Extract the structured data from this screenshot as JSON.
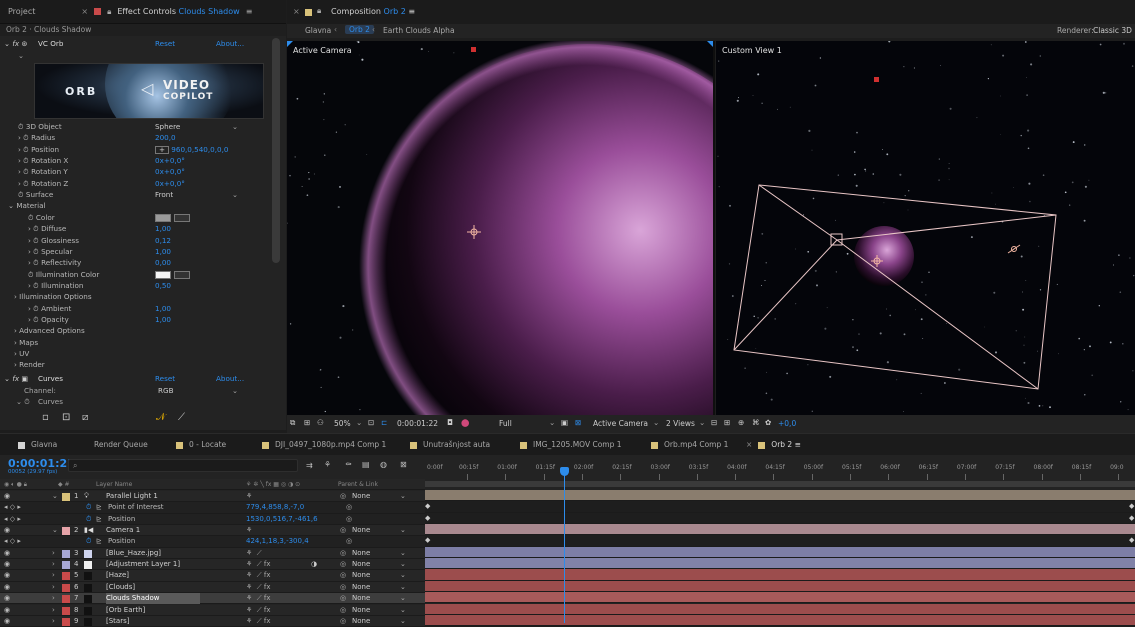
{
  "left_panel": {
    "tab_project": "Project",
    "tab_effect_controls_prefix": "Effect Controls ",
    "tab_effect_controls_layer": "Clouds Shadow",
    "subtitle": "Orb 2 · Clouds Shadow",
    "orb_effect": {
      "label": "VC Orb",
      "reset": "Reset",
      "about": "About..."
    },
    "banner_left": "ORB",
    "banner_right1": "VIDEO",
    "banner_right2": "COPILOT",
    "props": [
      {
        "label": "3D Object",
        "value": "Sphere",
        "kind": "dropdown"
      },
      {
        "label": "Radius",
        "value": "200,0",
        "kind": "num"
      },
      {
        "label": "Position",
        "value": "960,0,540,0,0,0",
        "kind": "pos"
      },
      {
        "label": "Rotation X",
        "value": "0x+0,0°",
        "kind": "num"
      },
      {
        "label": "Rotation Y",
        "value": "0x+0,0°",
        "kind": "num"
      },
      {
        "label": "Rotation Z",
        "value": "0x+0,0°",
        "kind": "num"
      },
      {
        "label": "Surface",
        "value": "Front",
        "kind": "dropdown"
      },
      {
        "label": "Material",
        "value": "",
        "kind": "group"
      },
      {
        "label": "Color",
        "value": "",
        "kind": "color-gray"
      },
      {
        "label": "Diffuse",
        "value": "1,00",
        "kind": "num"
      },
      {
        "label": "Glossiness",
        "value": "0,12",
        "kind": "num"
      },
      {
        "label": "Specular",
        "value": "1,00",
        "kind": "num"
      },
      {
        "label": "Reflectivity",
        "value": "0,00",
        "kind": "num"
      },
      {
        "label": "Illumination Color",
        "value": "",
        "kind": "color-white"
      },
      {
        "label": "Illumination",
        "value": "0,50",
        "kind": "num"
      },
      {
        "label": "Illumination Options",
        "value": "",
        "kind": "group"
      },
      {
        "label": "Ambient",
        "value": "1,00",
        "kind": "num"
      },
      {
        "label": "Opacity",
        "value": "1,00",
        "kind": "num"
      },
      {
        "label": "Advanced Options",
        "value": "",
        "kind": "group"
      },
      {
        "label": "Maps",
        "value": "",
        "kind": "group"
      },
      {
        "label": "UV",
        "value": "",
        "kind": "group"
      },
      {
        "label": "Render",
        "value": "",
        "kind": "group"
      }
    ],
    "curves": {
      "label": "Curves",
      "reset": "Reset",
      "about": "About...",
      "channel_label": "Channel:",
      "channel_value": "RGB",
      "curves_label": "Curves"
    }
  },
  "comp": {
    "tab_prefix": "Composition ",
    "tab_name": "Orb 2",
    "sub_tabs": [
      "Glavna",
      "Orb 2",
      "Earth Clouds Alpha"
    ],
    "renderer_label": "Renderer:",
    "renderer_value": "Classic 3D",
    "view_left_label": "Active Camera",
    "view_right_label": "Custom View 1",
    "viewer_bar": {
      "zoom": "50%",
      "timecode": "0:00:01:22",
      "quality": "Full",
      "camera": "Active Camera",
      "views": "2 Views",
      "exposure": "+0,0"
    }
  },
  "project_tabs": [
    {
      "label": "Glavna",
      "color": "#d4d4d4"
    },
    {
      "label": "Render Queue",
      "color": ""
    },
    {
      "label": "0 - Locate",
      "color": "#d9c27a"
    },
    {
      "label": "DJI_0497_1080p.mp4 Comp 1",
      "color": "#d9c27a"
    },
    {
      "label": "Unutrašnjost auta",
      "color": "#d9c27a"
    },
    {
      "label": "IMG_1205.MOV Comp 1",
      "color": "#d9c27a"
    },
    {
      "label": "Orb.mp4 Comp 1",
      "color": "#d9c27a"
    },
    {
      "label": "Orb 2",
      "color": "#d9c27a"
    }
  ],
  "timeline": {
    "timecode": "0:00:01:22",
    "frames": "00052 (29.97 fps)",
    "search_placeholder": "",
    "header": {
      "layer_name": "Layer Name",
      "parent_link": "Parent & Link"
    },
    "ruler": [
      "00:15f",
      "01:00f",
      "01:15f",
      "02:00f",
      "02:15f",
      "03:00f",
      "03:15f",
      "04:00f",
      "04:15f",
      "05:00f",
      "05:15f",
      "06:00f",
      "06:15f",
      "07:00f",
      "07:15f",
      "08:00f",
      "08:15f",
      "09:0"
    ],
    "ruler_start": "0:00f",
    "rows": [
      {
        "num": "1",
        "name": "Parallel Light 1",
        "value": "",
        "parent": "None",
        "color": "#d9c27a",
        "bar": "#8a7d6e",
        "kind": "layer"
      },
      {
        "num": "",
        "name": "Point of Interest",
        "value": "779,4,858,8,-7,0",
        "parent": "",
        "color": "",
        "bar": "",
        "kind": "prop"
      },
      {
        "num": "",
        "name": "Position",
        "value": "1530,0,516,7,-461,6",
        "parent": "",
        "color": "",
        "bar": "",
        "kind": "prop"
      },
      {
        "num": "2",
        "name": "Camera 1",
        "value": "",
        "parent": "None",
        "color": "#e6a3a8",
        "bar": "#a9898f",
        "kind": "layer"
      },
      {
        "num": "",
        "name": "Position",
        "value": "424,1,18,3,-300,4",
        "parent": "",
        "color": "",
        "bar": "",
        "kind": "prop"
      },
      {
        "num": "3",
        "name": "[Blue_Haze.jpg]",
        "value": "",
        "parent": "None",
        "color": "#a7a7d4",
        "bar": "#7d7ea6",
        "kind": "layer"
      },
      {
        "num": "4",
        "name": "[Adjustment Layer 1]",
        "value": "",
        "parent": "None",
        "color": "#a7a7d4",
        "bar": "#8182a8",
        "kind": "layer"
      },
      {
        "num": "5",
        "name": "[Haze]",
        "value": "",
        "parent": "None",
        "color": "#c94a4a",
        "bar": "#9c4d4d",
        "kind": "layer"
      },
      {
        "num": "6",
        "name": "[Clouds]",
        "value": "",
        "parent": "None",
        "color": "#c94a4a",
        "bar": "#9c4d4d",
        "kind": "layer"
      },
      {
        "num": "7",
        "name": "Clouds Shadow",
        "value": "",
        "parent": "None",
        "color": "#c94a4a",
        "bar": "#a85a5a",
        "kind": "layer-selected"
      },
      {
        "num": "8",
        "name": "[Orb Earth]",
        "value": "",
        "parent": "None",
        "color": "#c94a4a",
        "bar": "#9c4d4d",
        "kind": "layer"
      },
      {
        "num": "9",
        "name": "[Stars]",
        "value": "",
        "parent": "None",
        "color": "#c94a4a",
        "bar": "#9c4d4d",
        "kind": "layer"
      }
    ]
  },
  "colors": {
    "accent": "#2d8ceb",
    "panel": "#232323"
  }
}
